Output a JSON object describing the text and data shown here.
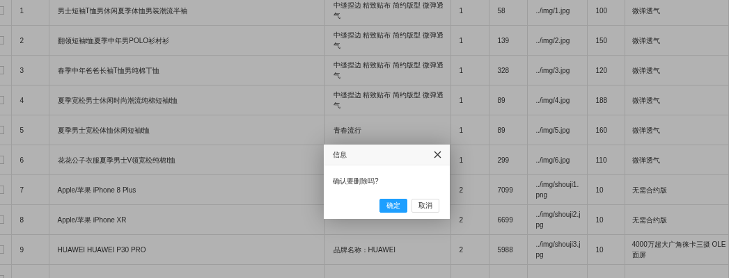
{
  "table": {
    "rows": [
      {
        "checked": false,
        "index": "1",
        "name": "男士短袖T恤男休闲夏季体恤男装潮流半袖",
        "desc": "中缝捏边 精致贴布 简约版型 微弹透气",
        "type": "1",
        "price": "58",
        "img": "../img/1.jpg",
        "num": "100",
        "feature": [
          "微弹透气"
        ]
      },
      {
        "checked": false,
        "index": "2",
        "name": "翻领短袖t恤夏季中年男POLO衫村衫",
        "desc": "中缝捏边 精致贴布 简约版型 微弹透气",
        "type": "1",
        "price": "139",
        "img": "../img/2.jpg",
        "num": "150",
        "feature": [
          "微弹透气"
        ]
      },
      {
        "checked": false,
        "index": "3",
        "name": "春季中年爸爸长袖T恤男纯棉丅恤",
        "desc": "中缝捏边 精致贴布 简约版型 微弹透气",
        "type": "1",
        "price": "328",
        "img": "../img/3.jpg",
        "num": "120",
        "feature": [
          "微弹透气"
        ]
      },
      {
        "checked": false,
        "index": "4",
        "name": "夏季宽松男士休闲时尚潮流纯棉短袖t恤",
        "desc": "中缝捏边 精致贴布 简约版型 微弹透气",
        "type": "1",
        "price": "89",
        "img": "../img/4.jpg",
        "num": "188",
        "feature": [
          "微弹透气"
        ]
      },
      {
        "checked": false,
        "index": "5",
        "name": "夏季男士宽松体恤休闲短袖t恤",
        "desc": "青春流行",
        "type": "1",
        "price": "89",
        "img": "../img/5.jpg",
        "num": "160",
        "feature": [
          "微弹透气"
        ]
      },
      {
        "checked": false,
        "index": "6",
        "name": "花花公子衣服夏季男士V领宽松纯棉t恤",
        "type": "1",
        "price": "299",
        "img": "../img/6.jpg",
        "num": "110",
        "feature": [
          "微弹透气"
        ]
      },
      {
        "checked": false,
        "index": "7",
        "name": "Apple/苹果 iPhone 8 Plus",
        "type": "2",
        "price": "7099",
        "img": "../img/shouji1.png",
        "num": "10",
        "feature": [
          "无需合约版"
        ]
      },
      {
        "checked": false,
        "index": "8",
        "name": "Apple/苹果 iPhone XR",
        "type": "2",
        "price": "6699",
        "img": "../img/shouji2.jpg",
        "num": "10",
        "feature": [
          "无需合约版"
        ]
      },
      {
        "checked": false,
        "index": "9",
        "name": "HUAWEI HUAWEI P30 PRO",
        "desc": "品牌名称：HUAWEI",
        "type": "2",
        "price": "5988",
        "img": "../img/shouji3.jpg",
        "num": "10",
        "feature": [
          "4000万超大广角徕卡三摄 OLE",
          "面屏"
        ]
      },
      {
        "checked": false
      }
    ]
  },
  "dialog": {
    "title": "信息",
    "message": "确认要删除吗?",
    "buttons": [
      {
        "label": "确定",
        "kind": "primary"
      },
      {
        "label": "取消",
        "kind": "secondary"
      }
    ]
  }
}
